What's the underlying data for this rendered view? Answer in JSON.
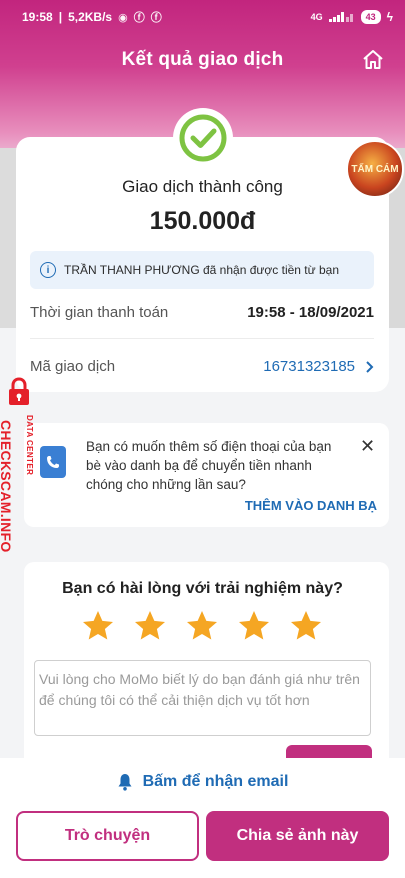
{
  "status_bar": {
    "time": "19:58",
    "speed": "5,2KB/s",
    "network": "4G",
    "battery": "43"
  },
  "header": {
    "title": "Kết quả giao dịch",
    "home_icon": "home-icon"
  },
  "receipt": {
    "status_icon": "check-circle-icon",
    "status_title": "Giao dịch thành công",
    "amount": "150.000đ",
    "notice": "TRẦN THANH PHƯƠNG đã nhận được tiền từ bạn",
    "time_label": "Thời gian thanh toán",
    "time_value": "19:58 - 18/09/2021",
    "code_label": "Mã giao dịch",
    "code_value": "16731323185"
  },
  "promo_avatar": {
    "text": "TẤM CÁM"
  },
  "contact_prompt": {
    "text": "Bạn có muốn thêm số điện thoại của bạn bè vào danh bạ để chuyển tiền nhanh chóng cho những lần sau?",
    "action": "THÊM VÀO DANH BẠ"
  },
  "rating": {
    "question": "Bạn có hài lòng với trải nghiệm này?",
    "stars": 5,
    "star_color": "#f5a623",
    "feedback_placeholder": "Vui lòng cho MoMo biết lý do bạn đánh giá như trên để chúng tôi có thể cải thiện dịch vụ tốt hơn"
  },
  "footer": {
    "email_link": "Bấm để nhận email",
    "chat_button": "Trò chuyện",
    "share_button": "Chia sẻ ảnh này"
  },
  "watermark": {
    "brand": "CHECKSCAM.INFO",
    "sub": "DATA CENTER"
  },
  "colors": {
    "brand": "#c12f7f",
    "link": "#1f6bb4",
    "success": "#7ec342"
  }
}
